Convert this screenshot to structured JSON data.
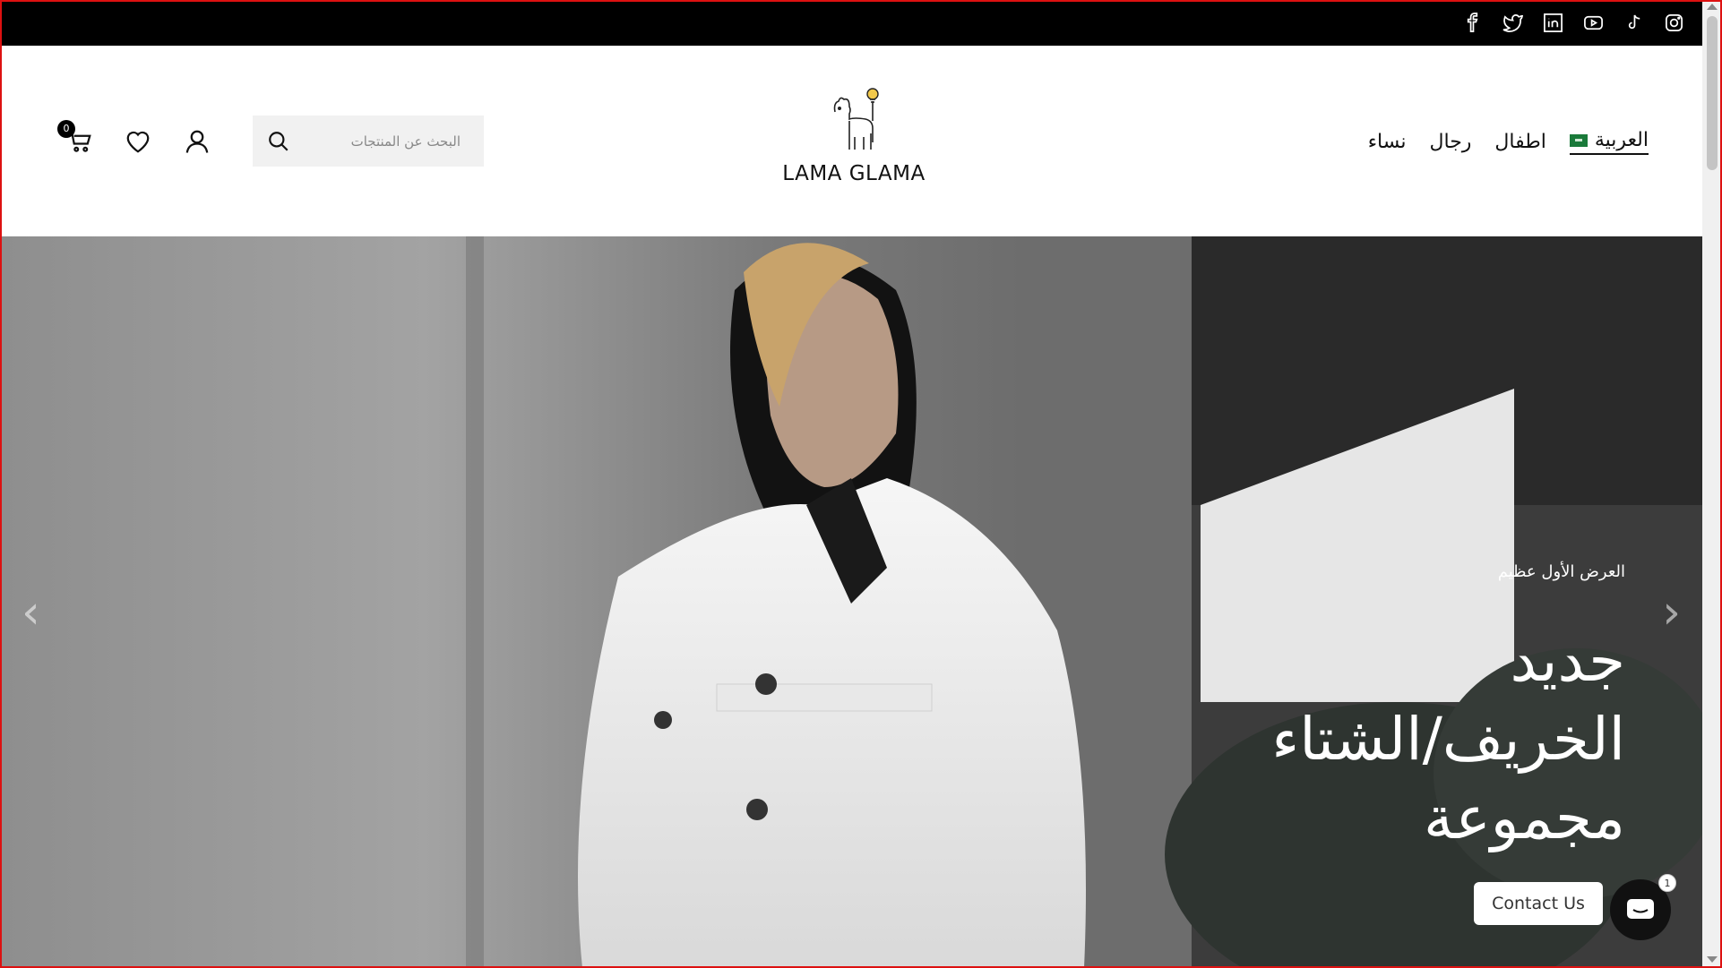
{
  "topbar": {
    "socials": [
      "facebook-icon",
      "twitter-icon",
      "linkedin-icon",
      "youtube-icon",
      "tiktok-icon",
      "instagram-icon"
    ]
  },
  "header": {
    "nav": {
      "women": "نساء",
      "men": "رجال",
      "kids": "اطفال",
      "language": "العربية"
    },
    "logo_text": "LAMA GLAMA",
    "search": {
      "placeholder": "البحث عن المنتجات"
    },
    "cart_count": "0"
  },
  "hero": {
    "eyebrow": "العرض الأول عظيم",
    "headline_line1": "جديد",
    "headline_line2": "الخريف/الشتاء",
    "headline_line3": "مجموعة",
    "prev_arrow": "‹",
    "next_arrow": "›"
  },
  "contact": {
    "label": "Contact Us",
    "badge": "1"
  },
  "colors": {
    "topbar": "#000000",
    "flag": "#1a7a3a"
  }
}
